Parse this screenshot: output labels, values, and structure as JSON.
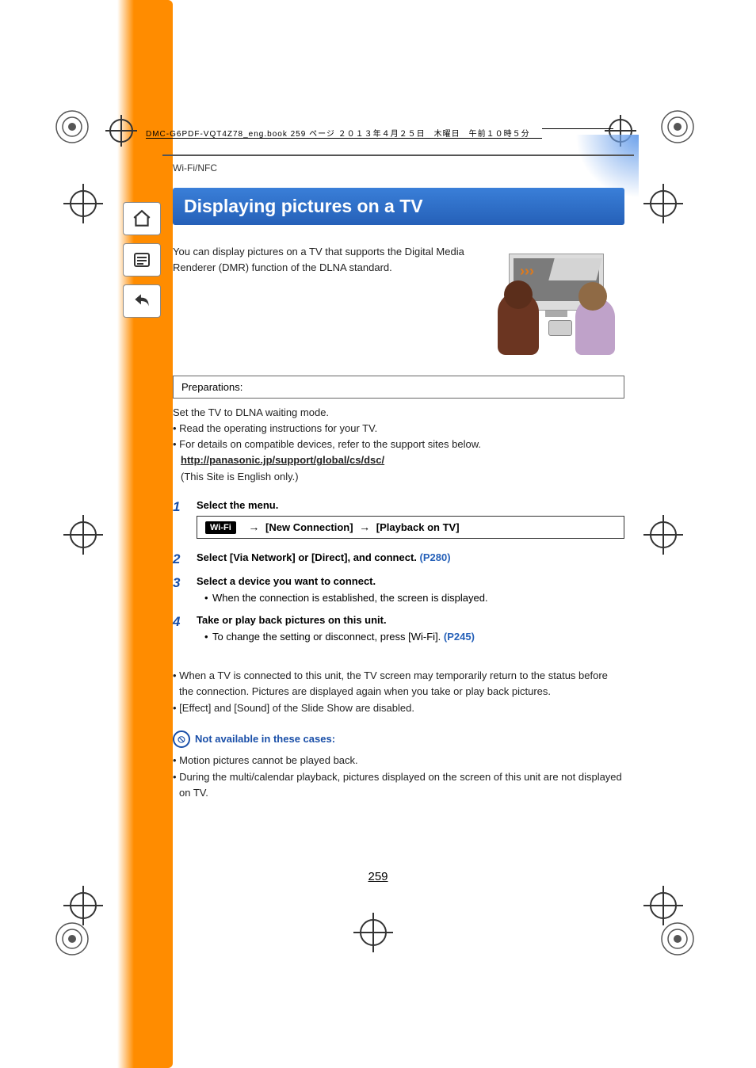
{
  "header_line": "DMC-G6PDF-VQT4Z78_eng.book  259 ページ  ２０１３年４月２５日　木曜日　午前１０時５分",
  "breadcrumb": "Wi-Fi/NFC",
  "title": "Displaying pictures on a TV",
  "intro": "You can display pictures on a TV that supports the Digital Media Renderer (DMR) function of the DLNA standard.",
  "prep_label": "Preparations:",
  "prep_lines": {
    "l1": "Set the TV to DLNA waiting mode.",
    "l2": "• Read the operating instructions for your TV.",
    "l3": "• For details on compatible devices, refer to the support sites below.",
    "link": "http://panasonic.jp/support/global/cs/dsc/",
    "l4": "(This Site is English only.)"
  },
  "wifi_badge": "Wi-Fi",
  "menu_path_a": "[New Connection]",
  "menu_path_b": "[Playback on TV]",
  "steps": {
    "s1": {
      "num": "1",
      "title": "Select the menu."
    },
    "s2": {
      "num": "2",
      "title_a": "Select [Via Network] or [Direct], and connect. ",
      "ref": "(P280)"
    },
    "s3": {
      "num": "3",
      "title": "Select a device you want to connect.",
      "sub": "When the connection is established, the screen is displayed."
    },
    "s4": {
      "num": "4",
      "title": "Take or play back pictures on this unit.",
      "sub_a": "To change the setting or disconnect, press [Wi-Fi]. ",
      "ref": "(P245)"
    }
  },
  "footnotes": {
    "f1": "When a TV is connected to this unit, the TV screen may temporarily return to the status before the connection. Pictures are displayed again when you take or play back pictures.",
    "f2": "[Effect] and [Sound] of the Slide Show are disabled."
  },
  "nac_title": "Not available in these cases:",
  "nac": {
    "n1": "Motion pictures cannot be played back.",
    "n2": "During the multi/calendar playback, pictures displayed on the screen of this unit are not displayed on TV."
  },
  "page_number": "259",
  "nav": {
    "home": "⌂",
    "toc": "☰",
    "back": "↶"
  }
}
